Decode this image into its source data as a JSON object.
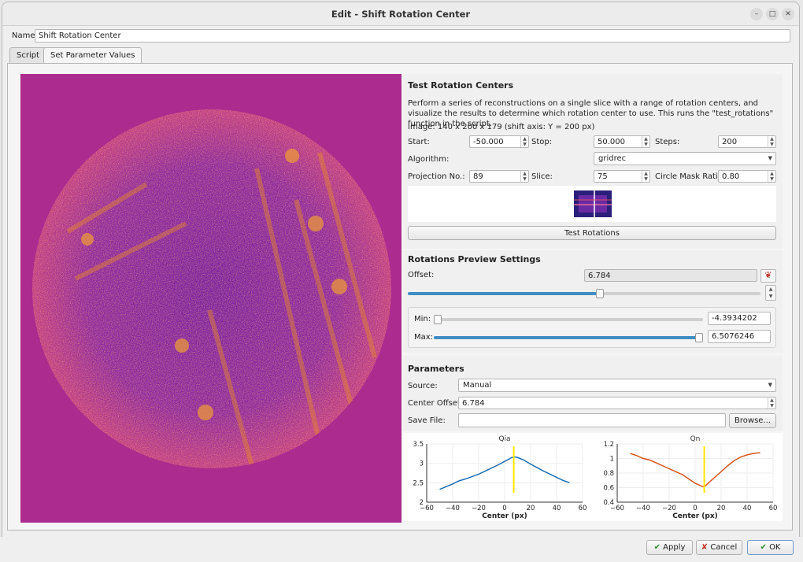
{
  "window": {
    "title": "Edit - Shift Rotation Center"
  },
  "name_row": {
    "label": "Name",
    "value": "Shift Rotation Center"
  },
  "tabs": [
    {
      "label": "Script"
    },
    {
      "label": "Set Parameter Values"
    }
  ],
  "test_rotation": {
    "title": "Test Rotation Centers",
    "description": "Perform a series of reconstructions on a single slice with a range of rotation centers, and visualize the results to determine which rotation center to use. This runs the \"test_rotations\" function in the script.",
    "image_info": "Image: 140 x 200 x 179 (shift axis: Y = 200 px)",
    "start_label": "Start:",
    "start_value": "-50.000",
    "stop_label": "Stop:",
    "stop_value": "50.000",
    "steps_label": "Steps:",
    "steps_value": "200",
    "algorithm_label": "Algorithm:",
    "algorithm_value": "gridrec",
    "projection_label": "Projection No.:",
    "projection_value": "89",
    "slice_label": "Slice:",
    "slice_value": "75",
    "mask_label": "Circle Mask Ratio:",
    "mask_value": "0.80",
    "button": "Test Rotations"
  },
  "preview": {
    "title": "Rotations Preview Settings",
    "offset_label": "Offset:",
    "offset_value": "6.784",
    "offset_slider_fraction": 0.545,
    "min_label": "Min:",
    "min_value": "-4.3934202",
    "min_fraction": 0.0,
    "max_label": "Max:",
    "max_value": "6.5076246",
    "max_fraction": 1.0
  },
  "parameters": {
    "title": "Parameters",
    "source_label": "Source:",
    "source_value": "Manual",
    "center_label": "Center Offset:",
    "center_value": "6.784",
    "save_label": "Save File:",
    "save_value": "",
    "browse": "Browse..."
  },
  "chart_data": [
    {
      "type": "line",
      "title": "Qia",
      "xlabel": "Center (px)",
      "ylabel": "",
      "xlim": [
        -60,
        60
      ],
      "ylim": [
        2,
        3.5
      ],
      "xticks": [
        "−60",
        "−40",
        "−20",
        "0",
        "20",
        "40",
        "60"
      ],
      "yticks": [
        "2",
        "2.5",
        "3",
        "3.5"
      ],
      "series": [
        {
          "x": [
            -50,
            -45,
            -40,
            -35,
            -30,
            -25,
            -20,
            -15,
            -10,
            -5,
            0,
            5,
            7,
            10,
            15,
            20,
            25,
            30,
            35,
            40,
            45,
            50
          ],
          "y": [
            2.33,
            2.4,
            2.47,
            2.55,
            2.6,
            2.66,
            2.72,
            2.8,
            2.88,
            2.96,
            3.05,
            3.14,
            3.17,
            3.15,
            3.08,
            2.98,
            2.89,
            2.8,
            2.72,
            2.64,
            2.56,
            2.5
          ],
          "color": "#1f6fb5"
        }
      ],
      "marker_x": 7,
      "marker_color": "#ffe800"
    },
    {
      "type": "line",
      "title": "Qn",
      "xlabel": "Center (px)",
      "ylabel": "",
      "xlim": [
        -60,
        60
      ],
      "ylim": [
        0.4,
        1.2
      ],
      "xticks": [
        "−60",
        "−40",
        "−20",
        "0",
        "20",
        "40",
        "60"
      ],
      "yticks": [
        "0.4",
        "0.6",
        "0.8",
        "1",
        "1.2"
      ],
      "series": [
        {
          "x": [
            -50,
            -45,
            -40,
            -35,
            -30,
            -25,
            -20,
            -15,
            -10,
            -5,
            0,
            5,
            7,
            10,
            15,
            20,
            25,
            30,
            35,
            40,
            45,
            50
          ],
          "y": [
            1.07,
            1.04,
            1.0,
            0.98,
            0.94,
            0.9,
            0.86,
            0.82,
            0.78,
            0.72,
            0.66,
            0.62,
            0.61,
            0.66,
            0.74,
            0.82,
            0.9,
            0.97,
            1.02,
            1.05,
            1.07,
            1.08
          ],
          "color": "#d9541a"
        }
      ],
      "marker_x": 7,
      "marker_color": "#ffe800"
    }
  ],
  "footer": {
    "apply": "Apply",
    "cancel": "Cancel",
    "ok": "OK"
  },
  "colors": {
    "background_magenta": "#ab2b8f",
    "slider_blue": "#3f8ec2"
  }
}
